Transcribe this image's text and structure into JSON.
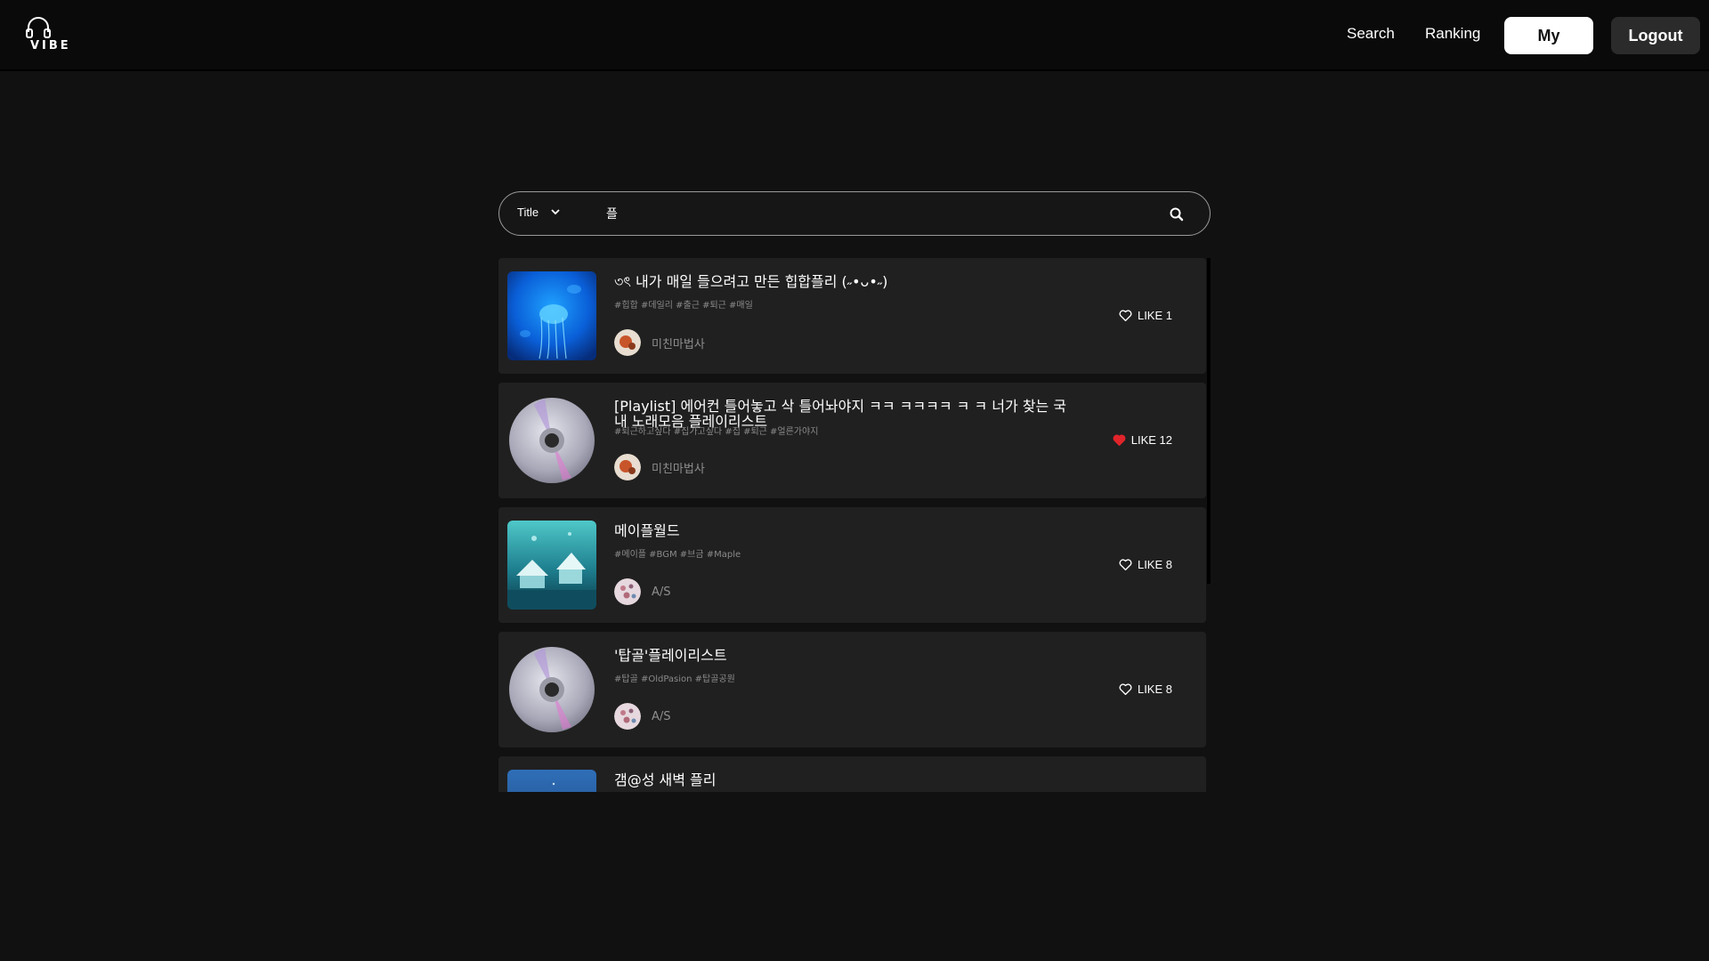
{
  "header": {
    "logo_text": "VIBE",
    "nav": {
      "search": "Search",
      "ranking": "Ranking"
    },
    "my_label": "My",
    "logout_label": "Logout"
  },
  "search": {
    "filter_selected": "Title",
    "query": "플"
  },
  "playlists": [
    {
      "title": "৩ৎ 내가 매일 들으려고 만든 힙합플리 (˶•ᴗ•˶)",
      "tags": "#힙합 #데일리 #출근 #퇴근 #매일",
      "author": "미친마법사",
      "like_label": "LIKE 1",
      "liked": false,
      "thumb": "jellyfish"
    },
    {
      "title": "[Playlist] 에어컨 틀어놓고 삭 틀어놔야지 ㅋㅋ ㅋㅋㅋㅋ ㅋ ㅋ 너가 찾는 국내 노래모음 플레이리스트",
      "tags": "#퇴근하고싶다 #집가고싶다 #집 #퇴근 #얼른가야지",
      "author": "미친마법사",
      "like_label": "LIKE 12",
      "liked": true,
      "thumb": "cd"
    },
    {
      "title": "메이플월드",
      "tags": "#메이플 #BGM #브금 #Maple",
      "author": "A/S",
      "like_label": "LIKE 8",
      "liked": false,
      "thumb": "maple"
    },
    {
      "title": "'탑골'플레이리스트",
      "tags": "#탑골 #OldPasion #탑골공원",
      "author": "A/S",
      "like_label": "LIKE 8",
      "liked": false,
      "thumb": "cd"
    },
    {
      "title": "갬@성 새벽 플리",
      "tags": "",
      "author": "",
      "like_label": "",
      "liked": false,
      "thumb": "night"
    }
  ],
  "colors": {
    "background": "#111111",
    "card": "#202020",
    "liked_heart": "#e0242a"
  }
}
